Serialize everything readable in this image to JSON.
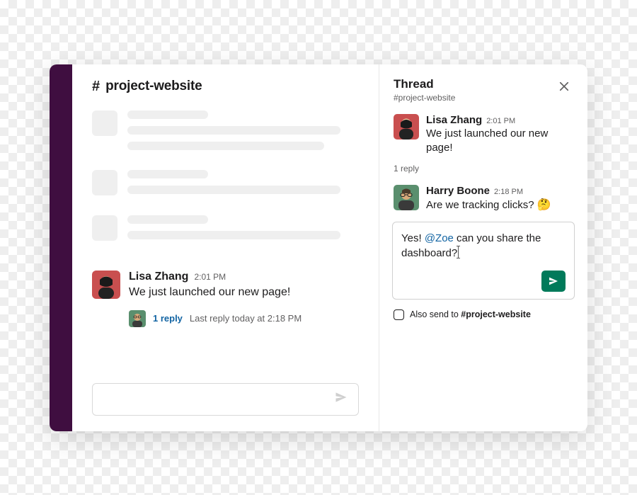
{
  "channel": {
    "hash": "#",
    "name": "project-website"
  },
  "main_message": {
    "author": "Lisa Zhang",
    "time": "2:01 PM",
    "text": "We just launched our new page!"
  },
  "thread_summary": {
    "replies_label": "1 reply",
    "last_reply": "Last reply today at 2:18 PM"
  },
  "thread": {
    "title": "Thread",
    "subtitle": "#project-website",
    "reply_count_label": "1 reply",
    "messages": [
      {
        "author": "Lisa Zhang",
        "time": "2:01 PM",
        "text": "We just launched our new page!"
      },
      {
        "author": "Harry Boone",
        "time": "2:18 PM",
        "text_pre": "Are we tracking clicks? ",
        "emoji": "🤔"
      }
    ],
    "composer": {
      "prefix": "Yes! ",
      "mention": "@Zoe",
      "suffix": " can you share the dashboard?"
    },
    "also_send": {
      "prefix": "Also send to ",
      "channel": "#project-website"
    }
  }
}
